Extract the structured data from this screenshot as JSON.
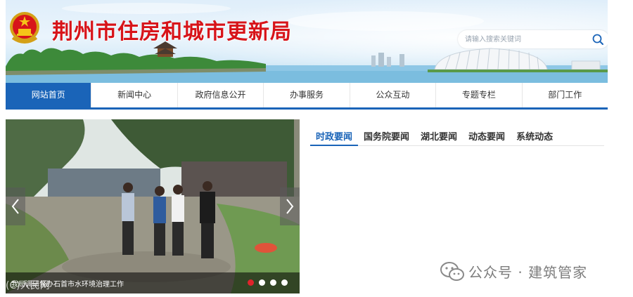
{
  "header": {
    "site_title": "荆州市住房和城市更新局",
    "search_placeholder": "请输入搜索关键词",
    "emblem_icon": "national-emblem-icon",
    "search_icon": "search-icon"
  },
  "nav": {
    "items": [
      {
        "label": "网站首页",
        "active": true
      },
      {
        "label": "新闻中心",
        "active": false
      },
      {
        "label": "政府信息公开",
        "active": false
      },
      {
        "label": "办事服务",
        "active": false
      },
      {
        "label": "公众互动",
        "active": false
      },
      {
        "label": "专题专栏",
        "active": false
      },
      {
        "label": "部门工作",
        "active": false
      }
    ]
  },
  "slider": {
    "caption": "我局调研督办石首市水环境治理工作",
    "watermark": "(C)人民网",
    "dots": 4,
    "active_dot": 1,
    "prev_icon": "chevron-left-icon",
    "next_icon": "chevron-right-icon"
  },
  "news": {
    "tabs": [
      {
        "label": "时政要闻",
        "active": true
      },
      {
        "label": "国务院要闻",
        "active": false
      },
      {
        "label": "湖北要闻",
        "active": false
      },
      {
        "label": "动态要闻",
        "active": false
      },
      {
        "label": "系统动态",
        "active": false
      }
    ]
  },
  "watermark": {
    "text": "公众号 · 建筑管家",
    "icon": "wechat-icon"
  },
  "colors": {
    "brand_blue": "#1a64b8",
    "title_red": "#d7141a",
    "dot_active": "#e0242b"
  }
}
